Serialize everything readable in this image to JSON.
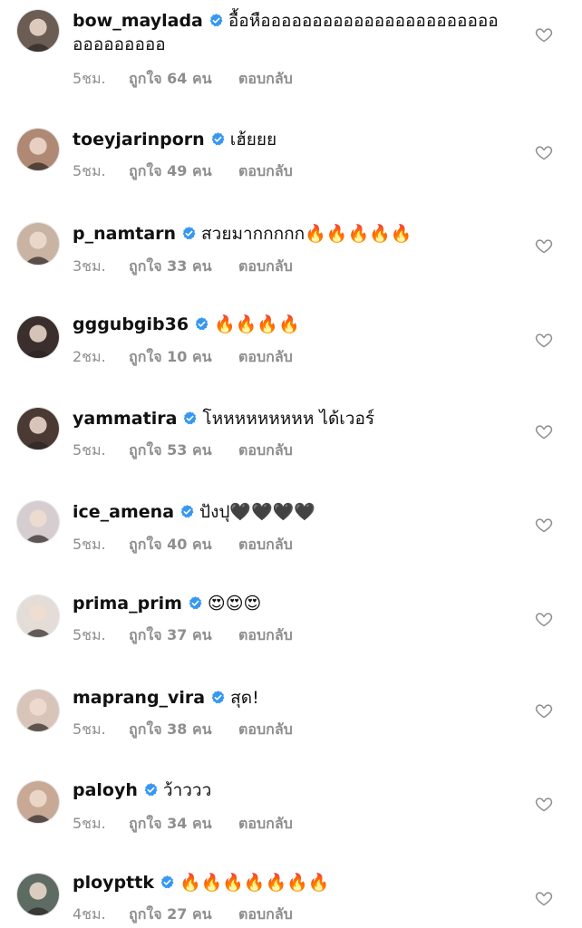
{
  "comments": [
    {
      "username": "bow_maylada",
      "text": "อื้อหืออออออออออออออออออออออออออออออออ",
      "time": "5ชม.",
      "likes": "ถูกใจ 64 คน",
      "reply": "ตอบกลับ",
      "avatar_color": "#6b5d54"
    },
    {
      "username": "toeyjarinporn",
      "text": "เฮ้ยยย",
      "time": "5ชม.",
      "likes": "ถูกใจ 49 คน",
      "reply": "ตอบกลับ",
      "avatar_color": "#b08974"
    },
    {
      "username": "p_namtarn",
      "text": "สวยมากกกกก🔥🔥🔥🔥🔥",
      "time": "3ชม.",
      "likes": "ถูกใจ 33 คน",
      "reply": "ตอบกลับ",
      "avatar_color": "#c9b3a3"
    },
    {
      "username": "gggubgib36",
      "text": "🔥🔥🔥🔥",
      "time": "2ชม.",
      "likes": "ถูกใจ 10 คน",
      "reply": "ตอบกลับ",
      "avatar_color": "#3a2f2c"
    },
    {
      "username": "yammatira",
      "text": "โหหหหหหหหห ได้เวอร์",
      "time": "5ชม.",
      "likes": "ถูกใจ 53 คน",
      "reply": "ตอบกลับ",
      "avatar_color": "#4a3a33"
    },
    {
      "username": "ice_amena",
      "text": "ปังปุ🖤🖤🖤🖤",
      "time": "5ชม.",
      "likes": "ถูกใจ 40 คน",
      "reply": "ตอบกลับ",
      "avatar_color": "#d6cdd0"
    },
    {
      "username": "prima_prim",
      "text": "😍😍😍",
      "time": "5ชม.",
      "likes": "ถูกใจ 37 คน",
      "reply": "ตอบกลับ",
      "avatar_color": "#e4dcd6"
    },
    {
      "username": "maprang_vira",
      "text": "สุด!",
      "time": "5ชม.",
      "likes": "ถูกใจ 38 คน",
      "reply": "ตอบกลับ",
      "avatar_color": "#d8c4b8"
    },
    {
      "username": "paloyh",
      "text": "ว้าววว",
      "time": "5ชม.",
      "likes": "ถูกใจ 34 คน",
      "reply": "ตอบกลับ",
      "avatar_color": "#c7a996"
    },
    {
      "username": "ploypttk",
      "text": "🔥🔥🔥🔥🔥🔥🔥",
      "time": "4ชม.",
      "likes": "ถูกใจ 27 คน",
      "reply": "ตอบกลับ",
      "avatar_color": "#5d6b63"
    }
  ],
  "colors": {
    "verified": "#3897f0",
    "meta": "#8e8e8e",
    "heart": "#8e8e8e"
  },
  "icons": {
    "verified": "verified-badge-icon",
    "like": "heart-outline-icon"
  }
}
